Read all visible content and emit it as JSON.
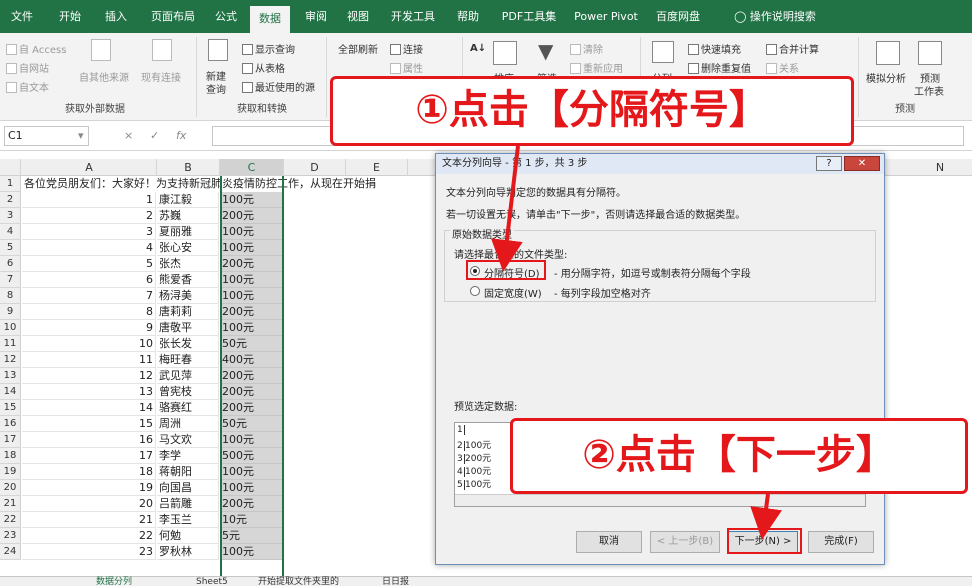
{
  "menu": {
    "tabs": [
      "文件",
      "开始",
      "插入",
      "页面布局",
      "公式",
      "数据",
      "审阅",
      "视图",
      "开发工具",
      "帮助",
      "PDF工具集",
      "Power Pivot",
      "百度网盘"
    ],
    "active": "数据",
    "tell_me": "操作说明搜索"
  },
  "ribbon": {
    "access": "自 Access",
    "web": "自网站",
    "text": "自文本",
    "other": "自其他来源",
    "existing": "现有连接",
    "group_external": "获取外部数据",
    "new_query_1": "新建",
    "new_query_2": "查询",
    "show_query": "显示查询",
    "from_table": "从表格",
    "recent": "最近使用的源",
    "group_transform": "获取和转换",
    "refresh_all": "全部刷新",
    "connections": "连接",
    "properties": "属性",
    "sort": "排序",
    "filter": "筛选",
    "clear": "清除",
    "reapply": "重新应用",
    "split": "分列",
    "flash_fill": "快速填充",
    "remove_dup": "删除重复值",
    "consolidate": "合并计算",
    "relations": "关系",
    "whatif": "模拟分析",
    "forecast_1": "预测",
    "forecast_2": "工作表",
    "group_forecast": "预测"
  },
  "formula_bar": {
    "name_box": "C1",
    "fx": "fx",
    "cancel": "×",
    "enter": "✓"
  },
  "columns": [
    "A",
    "B",
    "C",
    "D",
    "E",
    "N"
  ],
  "cell_a1": "各位党员朋友们：大家好！为支持新冠肺炎疫情防控工作，从现在开始捐",
  "rows": [
    {
      "r": "2",
      "a": "1",
      "b": "康江毅",
      "c": "100元"
    },
    {
      "r": "3",
      "a": "2",
      "b": "苏巍",
      "c": "200元"
    },
    {
      "r": "4",
      "a": "3",
      "b": "夏丽雅",
      "c": "100元"
    },
    {
      "r": "5",
      "a": "4",
      "b": "张心安",
      "c": "100元"
    },
    {
      "r": "6",
      "a": "5",
      "b": "张杰",
      "c": "200元"
    },
    {
      "r": "7",
      "a": "6",
      "b": "熊爱香",
      "c": "100元"
    },
    {
      "r": "8",
      "a": "7",
      "b": "杨浔美",
      "c": "100元"
    },
    {
      "r": "9",
      "a": "8",
      "b": "唐莉莉",
      "c": "200元"
    },
    {
      "r": "10",
      "a": "9",
      "b": "唐敬平",
      "c": "100元"
    },
    {
      "r": "11",
      "a": "10",
      "b": "张长发",
      "c": "50元"
    },
    {
      "r": "12",
      "a": "11",
      "b": "梅旺春",
      "c": "400元"
    },
    {
      "r": "13",
      "a": "12",
      "b": "武见萍",
      "c": "200元"
    },
    {
      "r": "14",
      "a": "13",
      "b": "曾宪枝",
      "c": "200元"
    },
    {
      "r": "15",
      "a": "14",
      "b": "骆赛红",
      "c": "200元"
    },
    {
      "r": "16",
      "a": "15",
      "b": "周洲",
      "c": "50元"
    },
    {
      "r": "17",
      "a": "16",
      "b": "马文欢",
      "c": "100元"
    },
    {
      "r": "18",
      "a": "17",
      "b": "李学",
      "c": "500元"
    },
    {
      "r": "19",
      "a": "18",
      "b": "蒋朝阳",
      "c": "100元"
    },
    {
      "r": "20",
      "a": "19",
      "b": "向国昌",
      "c": "100元"
    },
    {
      "r": "21",
      "a": "20",
      "b": "吕箭雕",
      "c": "200元"
    },
    {
      "r": "22",
      "a": "21",
      "b": "李玉兰",
      "c": "10元"
    },
    {
      "r": "23",
      "a": "22",
      "b": "何勉",
      "c": "5元"
    },
    {
      "r": "24",
      "a": "23",
      "b": "罗秋林",
      "c": "100元"
    }
  ],
  "dialog": {
    "title": "文本分列向导 - 第 1 步，共 3 步",
    "help": "?",
    "close": "✕",
    "line1": "文本分列向导判定您的数据具有分隔符。",
    "line2": "若一切设置无误，请单击\"下一步\"，否则请选择最合适的数据类型。",
    "group_label": "原始数据类型",
    "choose": "请选择最合适的文件类型:",
    "opt1": "分隔符号(D)",
    "opt1_desc": "- 用分隔字符，如逗号或制表符分隔每个字段",
    "opt2": "固定宽度(W)",
    "opt2_desc": "- 每列字段加空格对齐",
    "preview_label": "预览选定数据:",
    "preview_lines": [
      {
        "n": "1",
        "t": ""
      },
      {
        "n": "2",
        "t": "100元"
      },
      {
        "n": "3",
        "t": "200元"
      },
      {
        "n": "4",
        "t": "100元"
      },
      {
        "n": "5",
        "t": "100元"
      }
    ],
    "cancel": "取消",
    "back": "< 上一步(B)",
    "next": "下一步(N) >",
    "finish": "完成(F)"
  },
  "annotations": {
    "step1": "①点击【分隔符号】",
    "step2": "②点击【下一步】",
    "accent": "#e4171b"
  },
  "sheet_tabs": [
    "数据分列",
    "Sheet5",
    "开始提取文件夹里的",
    "日日报"
  ]
}
